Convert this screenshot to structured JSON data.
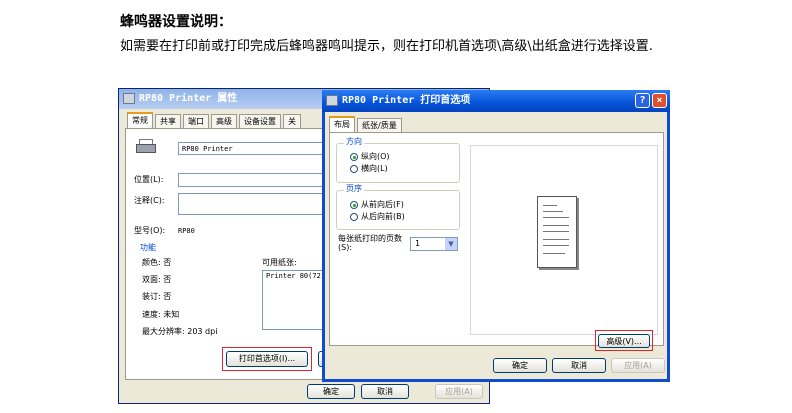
{
  "doc": {
    "title": "蜂鸣器设置说明：",
    "paragraph": "如需要在打印前或打印完成后蜂鸣器鸣叫提示，则在打印机首选项\\高级\\出纸盒进行选择设置."
  },
  "properties_window": {
    "title": "RP80 Printer 属性",
    "tabs": [
      "常规",
      "共享",
      "端口",
      "高级",
      "设备设置",
      "关"
    ],
    "printer_name": "RP80 Printer",
    "location_label": "位置(L):",
    "comment_label": "注释(C):",
    "model_label": "型号(O):",
    "model_value": "RP80",
    "features_title": "功能",
    "color_label": "颜色: 否",
    "duplex_label": "双面: 否",
    "staple_label": "装订: 否",
    "speed_label": "速度: 未知",
    "resolution_label": "最大分辨率: 203 dpi",
    "paper_label": "可用纸张:",
    "paper_item": "Printer 80(72",
    "print_prefs_button": "打印首选项(I)...",
    "ok_button": "确定",
    "cancel_button": "取消",
    "apply_button": "应用(A)"
  },
  "preferences_window": {
    "title": "RP80 Printer 打印首选项",
    "tabs": [
      "布局",
      "纸张/质量"
    ],
    "orientation_title": "方向",
    "portrait": "纵向(O)",
    "landscape": "横向(L)",
    "order_title": "页序",
    "front_to_back": "从前向后(F)",
    "back_to_front": "从后向前(B)",
    "pages_per_sheet_label": "每张纸打印的页数(S):",
    "pages_per_sheet_value": "1",
    "advanced_button": "高级(V)...",
    "ok_button": "确定",
    "cancel_button": "取消",
    "apply_button": "应用(A)",
    "help_icon": "?",
    "close_icon": "×"
  },
  "colors": {
    "highlight_box": "#e0262e",
    "titlebar": "#0553d9"
  }
}
